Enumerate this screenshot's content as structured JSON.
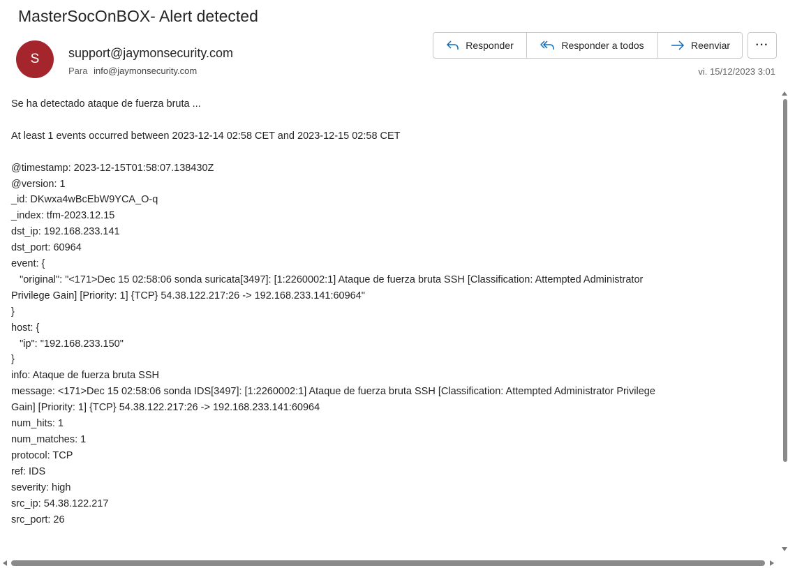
{
  "email": {
    "subject": "MasterSocOnBOX- Alert detected",
    "avatar_initial": "S",
    "avatar_color": "#a4262c",
    "sender": "support@jaymonsecurity.com",
    "to_label": "Para",
    "to_address": "info@jaymonsecurity.com",
    "date": "vi. 15/12/2023 3:01"
  },
  "actions": {
    "reply_label": "Responder",
    "reply_all_label": "Responder a todos",
    "forward_label": "Reenviar",
    "more_label": "···",
    "reply_icon": "reply-arrow-icon",
    "reply_all_icon": "reply-all-arrow-icon",
    "forward_icon": "forward-arrow-icon",
    "accent_color": "#0f6cbd"
  },
  "body": {
    "lines": [
      "Se ha detectado ataque de fuerza bruta ...",
      "",
      "At least 1 events occurred between 2023-12-14 02:58 CET and 2023-12-15 02:58 CET",
      "",
      "@timestamp: 2023-12-15T01:58:07.138430Z",
      "@version: 1",
      "_id: DKwxa4wBcEbW9YCA_O-q",
      "_index: tfm-2023.12.15",
      "dst_ip: 192.168.233.141",
      "dst_port: 60964",
      "event: {",
      "   \"original\": \"<171>Dec 15 02:58:06 sonda suricata[3497]: [1:2260002:1] Ataque de fuerza bruta SSH [Classification: Attempted Administrator",
      "Privilege Gain] [Priority: 1] {TCP} 54.38.122.217:26 -> 192.168.233.141:60964\"",
      "}",
      "host: {",
      "   \"ip\": \"192.168.233.150\"",
      "}",
      "info: Ataque de fuerza bruta SSH",
      "message: <171>Dec 15 02:58:06 sonda IDS[3497]: [1:2260002:1] Ataque de fuerza bruta SSH [Classification: Attempted Administrator Privilege",
      "Gain] [Priority: 1] {TCP} 54.38.122.217:26 -> 192.168.233.141:60964",
      "num_hits: 1",
      "num_matches: 1",
      "protocol: TCP",
      "ref: IDS",
      "severity: high",
      "src_ip: 54.38.122.217",
      "src_port: 26"
    ]
  }
}
